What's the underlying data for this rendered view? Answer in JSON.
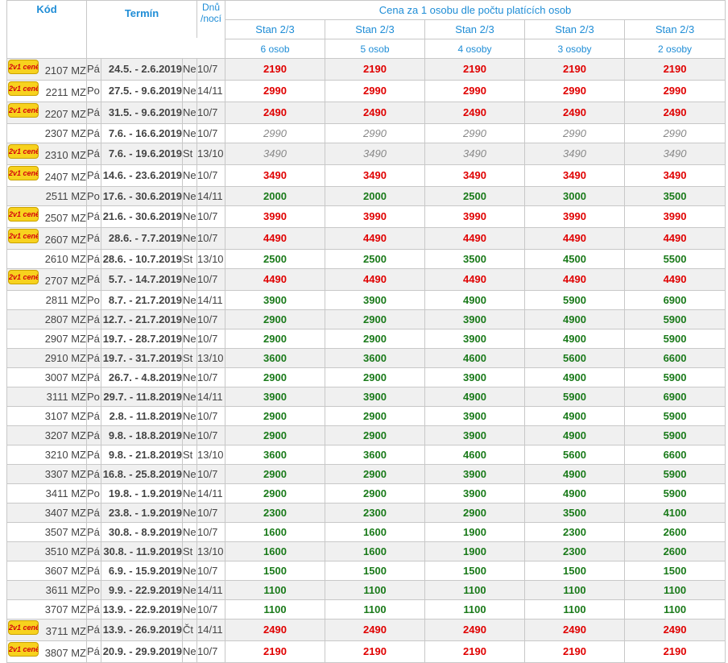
{
  "header": {
    "kod": "Kód",
    "termin": "Termín",
    "dnu": "Dnů",
    "noci": "/nocí",
    "cena": "Cena za 1 osobu dle počtu platících osob",
    "columns": [
      {
        "stan": "Stan 2/3",
        "osob": "6 osob"
      },
      {
        "stan": "Stan 2/3",
        "osob": "5 osob"
      },
      {
        "stan": "Stan 2/3",
        "osob": "4 osoby"
      },
      {
        "stan": "Stan 2/3",
        "osob": "3 osoby"
      },
      {
        "stan": "Stan 2/3",
        "osob": "2 osoby"
      }
    ]
  },
  "badge_text": "2v1 ceně",
  "colors": {
    "red": "#e00000",
    "green": "#1a7a1a",
    "grey": "#888888",
    "header": "#1f8dd6",
    "badge": "#f7d21e"
  },
  "rows": [
    {
      "code": "2107 MZ",
      "badge": true,
      "day": "Pá",
      "term": "24.5. - 2.6.2019",
      "dayend": "Ne",
      "nights": "10/7",
      "prices": [
        "2190",
        "2190",
        "2190",
        "2190",
        "2190"
      ],
      "style": "red"
    },
    {
      "code": "2211 MZ",
      "badge": true,
      "day": "Po",
      "term": "27.5. - 9.6.2019",
      "dayend": "Ne",
      "nights": "14/11",
      "prices": [
        "2990",
        "2990",
        "2990",
        "2990",
        "2990"
      ],
      "style": "red"
    },
    {
      "code": "2207 MZ",
      "badge": true,
      "day": "Pá",
      "term": "31.5. - 9.6.2019",
      "dayend": "Ne",
      "nights": "10/7",
      "prices": [
        "2490",
        "2490",
        "2490",
        "2490",
        "2490"
      ],
      "style": "red"
    },
    {
      "code": "2307 MZ",
      "badge": false,
      "day": "Pá",
      "term": "7.6. - 16.6.2019",
      "dayend": "Ne",
      "nights": "10/7",
      "prices": [
        "2990",
        "2990",
        "2990",
        "2990",
        "2990"
      ],
      "style": "grey"
    },
    {
      "code": "2310 MZ",
      "badge": true,
      "day": "Pá",
      "term": "7.6. - 19.6.2019",
      "dayend": "St",
      "nights": "13/10",
      "prices": [
        "3490",
        "3490",
        "3490",
        "3490",
        "3490"
      ],
      "style": "grey"
    },
    {
      "code": "2407 MZ",
      "badge": true,
      "day": "Pá",
      "term": "14.6. - 23.6.2019",
      "dayend": "Ne",
      "nights": "10/7",
      "prices": [
        "3490",
        "3490",
        "3490",
        "3490",
        "3490"
      ],
      "style": "red"
    },
    {
      "code": "2511 MZ",
      "badge": false,
      "day": "Po",
      "term": "17.6. - 30.6.2019",
      "dayend": "Ne",
      "nights": "14/11",
      "prices": [
        "2000",
        "2000",
        "2500",
        "3000",
        "3500"
      ],
      "style": "green"
    },
    {
      "code": "2507 MZ",
      "badge": true,
      "day": "Pá",
      "term": "21.6. - 30.6.2019",
      "dayend": "Ne",
      "nights": "10/7",
      "prices": [
        "3990",
        "3990",
        "3990",
        "3990",
        "3990"
      ],
      "style": "red"
    },
    {
      "code": "2607 MZ",
      "badge": true,
      "day": "Pá",
      "term": "28.6. - 7.7.2019",
      "dayend": "Ne",
      "nights": "10/7",
      "prices": [
        "4490",
        "4490",
        "4490",
        "4490",
        "4490"
      ],
      "style": "red"
    },
    {
      "code": "2610 MZ",
      "badge": false,
      "day": "Pá",
      "term": "28.6. - 10.7.2019",
      "dayend": "St",
      "nights": "13/10",
      "prices": [
        "2500",
        "2500",
        "3500",
        "4500",
        "5500"
      ],
      "style": "green"
    },
    {
      "code": "2707 MZ",
      "badge": true,
      "day": "Pá",
      "term": "5.7. - 14.7.2019",
      "dayend": "Ne",
      "nights": "10/7",
      "prices": [
        "4490",
        "4490",
        "4490",
        "4490",
        "4490"
      ],
      "style": "red"
    },
    {
      "code": "2811 MZ",
      "badge": false,
      "day": "Po",
      "term": "8.7. - 21.7.2019",
      "dayend": "Ne",
      "nights": "14/11",
      "prices": [
        "3900",
        "3900",
        "4900",
        "5900",
        "6900"
      ],
      "style": "green"
    },
    {
      "code": "2807 MZ",
      "badge": false,
      "day": "Pá",
      "term": "12.7. - 21.7.2019",
      "dayend": "Ne",
      "nights": "10/7",
      "prices": [
        "2900",
        "2900",
        "3900",
        "4900",
        "5900"
      ],
      "style": "green"
    },
    {
      "code": "2907 MZ",
      "badge": false,
      "day": "Pá",
      "term": "19.7. - 28.7.2019",
      "dayend": "Ne",
      "nights": "10/7",
      "prices": [
        "2900",
        "2900",
        "3900",
        "4900",
        "5900"
      ],
      "style": "green"
    },
    {
      "code": "2910 MZ",
      "badge": false,
      "day": "Pá",
      "term": "19.7. - 31.7.2019",
      "dayend": "St",
      "nights": "13/10",
      "prices": [
        "3600",
        "3600",
        "4600",
        "5600",
        "6600"
      ],
      "style": "green"
    },
    {
      "code": "3007 MZ",
      "badge": false,
      "day": "Pá",
      "term": "26.7. - 4.8.2019",
      "dayend": "Ne",
      "nights": "10/7",
      "prices": [
        "2900",
        "2900",
        "3900",
        "4900",
        "5900"
      ],
      "style": "green"
    },
    {
      "code": "3111 MZ",
      "badge": false,
      "day": "Po",
      "term": "29.7. - 11.8.2019",
      "dayend": "Ne",
      "nights": "14/11",
      "prices": [
        "3900",
        "3900",
        "4900",
        "5900",
        "6900"
      ],
      "style": "green"
    },
    {
      "code": "3107 MZ",
      "badge": false,
      "day": "Pá",
      "term": "2.8. - 11.8.2019",
      "dayend": "Ne",
      "nights": "10/7",
      "prices": [
        "2900",
        "2900",
        "3900",
        "4900",
        "5900"
      ],
      "style": "green"
    },
    {
      "code": "3207 MZ",
      "badge": false,
      "day": "Pá",
      "term": "9.8. - 18.8.2019",
      "dayend": "Ne",
      "nights": "10/7",
      "prices": [
        "2900",
        "2900",
        "3900",
        "4900",
        "5900"
      ],
      "style": "green"
    },
    {
      "code": "3210 MZ",
      "badge": false,
      "day": "Pá",
      "term": "9.8. - 21.8.2019",
      "dayend": "St",
      "nights": "13/10",
      "prices": [
        "3600",
        "3600",
        "4600",
        "5600",
        "6600"
      ],
      "style": "green"
    },
    {
      "code": "3307 MZ",
      "badge": false,
      "day": "Pá",
      "term": "16.8. - 25.8.2019",
      "dayend": "Ne",
      "nights": "10/7",
      "prices": [
        "2900",
        "2900",
        "3900",
        "4900",
        "5900"
      ],
      "style": "green"
    },
    {
      "code": "3411 MZ",
      "badge": false,
      "day": "Po",
      "term": "19.8. - 1.9.2019",
      "dayend": "Ne",
      "nights": "14/11",
      "prices": [
        "2900",
        "2900",
        "3900",
        "4900",
        "5900"
      ],
      "style": "green"
    },
    {
      "code": "3407 MZ",
      "badge": false,
      "day": "Pá",
      "term": "23.8. - 1.9.2019",
      "dayend": "Ne",
      "nights": "10/7",
      "prices": [
        "2300",
        "2300",
        "2900",
        "3500",
        "4100"
      ],
      "style": "green"
    },
    {
      "code": "3507 MZ",
      "badge": false,
      "day": "Pá",
      "term": "30.8. - 8.9.2019",
      "dayend": "Ne",
      "nights": "10/7",
      "prices": [
        "1600",
        "1600",
        "1900",
        "2300",
        "2600"
      ],
      "style": "green"
    },
    {
      "code": "3510 MZ",
      "badge": false,
      "day": "Pá",
      "term": "30.8. - 11.9.2019",
      "dayend": "St",
      "nights": "13/10",
      "prices": [
        "1600",
        "1600",
        "1900",
        "2300",
        "2600"
      ],
      "style": "green"
    },
    {
      "code": "3607 MZ",
      "badge": false,
      "day": "Pá",
      "term": "6.9. - 15.9.2019",
      "dayend": "Ne",
      "nights": "10/7",
      "prices": [
        "1500",
        "1500",
        "1500",
        "1500",
        "1500"
      ],
      "style": "green"
    },
    {
      "code": "3611 MZ",
      "badge": false,
      "day": "Po",
      "term": "9.9. - 22.9.2019",
      "dayend": "Ne",
      "nights": "14/11",
      "prices": [
        "1100",
        "1100",
        "1100",
        "1100",
        "1100"
      ],
      "style": "green"
    },
    {
      "code": "3707 MZ",
      "badge": false,
      "day": "Pá",
      "term": "13.9. - 22.9.2019",
      "dayend": "Ne",
      "nights": "10/7",
      "prices": [
        "1100",
        "1100",
        "1100",
        "1100",
        "1100"
      ],
      "style": "green"
    },
    {
      "code": "3711 MZ",
      "badge": true,
      "day": "Pá",
      "term": "13.9. - 26.9.2019",
      "dayend": "Čt",
      "nights": "14/11",
      "prices": [
        "2490",
        "2490",
        "2490",
        "2490",
        "2490"
      ],
      "style": "red"
    },
    {
      "code": "3807 MZ",
      "badge": true,
      "day": "Pá",
      "term": "20.9. - 29.9.2019",
      "dayend": "Ne",
      "nights": "10/7",
      "prices": [
        "2190",
        "2190",
        "2190",
        "2190",
        "2190"
      ],
      "style": "red"
    }
  ]
}
